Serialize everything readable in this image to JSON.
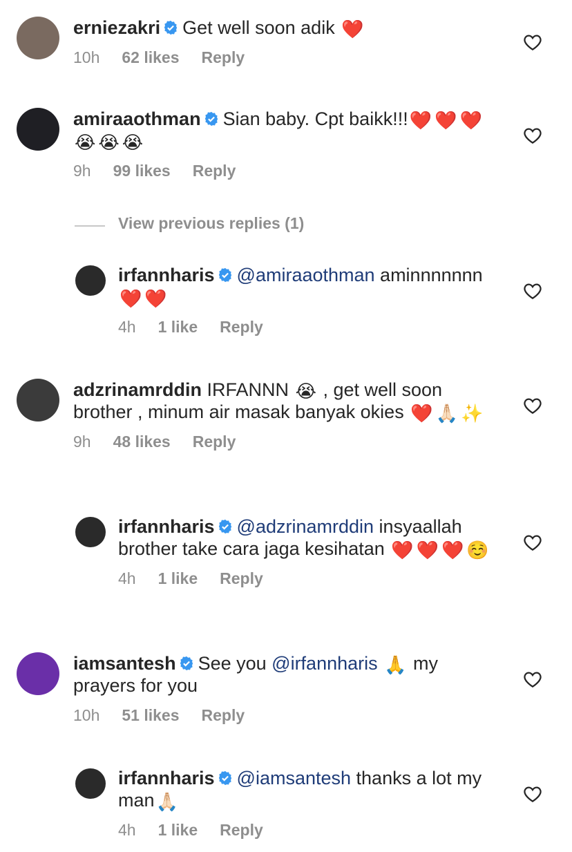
{
  "comments": [
    {
      "username": "erniezakri",
      "parts": [
        {
          "t": "text",
          "v": "Get well soon adik "
        },
        {
          "t": "emoji",
          "v": "❤️"
        }
      ],
      "time": "10h",
      "likes": "62 likes",
      "reply": "Reply",
      "avatar_color": "#7a6a60"
    },
    {
      "username": "amiraaothman",
      "parts": [
        {
          "t": "text",
          "v": "Sian baby. Cpt baikk!!!"
        },
        {
          "t": "emoji",
          "v": "❤️"
        },
        {
          "t": "emoji",
          "v": "❤️"
        },
        {
          "t": "emoji",
          "v": "❤️"
        },
        {
          "t": "emoji",
          "v": "😭"
        },
        {
          "t": "emoji",
          "v": "😭"
        },
        {
          "t": "emoji",
          "v": "😭"
        }
      ],
      "time": "9h",
      "likes": "99 likes",
      "reply": "Reply",
      "avatar_color": "#1f1f24"
    },
    {
      "username": "irfannharis",
      "parts": [
        {
          "t": "mention",
          "v": "@amiraaothman"
        },
        {
          "t": "text",
          "v": " aminnnnnnn"
        },
        {
          "t": "emoji",
          "v": "❤️"
        },
        {
          "t": "emoji",
          "v": "❤️"
        }
      ],
      "time": "4h",
      "likes": "1 like",
      "reply": "Reply",
      "avatar_color": "#2a2a2a"
    },
    {
      "username": "adzrinamrddin",
      "parts": [
        {
          "t": "text",
          "v": "IRFANNN "
        },
        {
          "t": "emoji",
          "v": "😭"
        },
        {
          "t": "text",
          "v": " , get well soon brother , minum air masak banyak okies "
        },
        {
          "t": "emoji",
          "v": "❤️"
        },
        {
          "t": "emoji",
          "v": "🙏🏻"
        },
        {
          "t": "emoji",
          "v": "✨"
        }
      ],
      "time": "9h",
      "likes": "48 likes",
      "reply": "Reply",
      "avatar_color": "#3b3b3b"
    },
    {
      "username": "irfannharis",
      "parts": [
        {
          "t": "mention",
          "v": "@adzrinamrddin"
        },
        {
          "t": "text",
          "v": " insyaallah brother take cara jaga kesihatan "
        },
        {
          "t": "emoji",
          "v": "❤️"
        },
        {
          "t": "emoji",
          "v": "❤️"
        },
        {
          "t": "emoji",
          "v": "❤️"
        },
        {
          "t": "emoji",
          "v": "☺️"
        }
      ],
      "time": "4h",
      "likes": "1 like",
      "reply": "Reply",
      "avatar_color": "#2a2a2a"
    },
    {
      "username": "iamsantesh",
      "parts": [
        {
          "t": "text",
          "v": "See you "
        },
        {
          "t": "mention",
          "v": "@irfannharis"
        },
        {
          "t": "text",
          "v": " "
        },
        {
          "t": "emoji",
          "v": "🙏"
        },
        {
          "t": "text",
          "v": " my prayers for you"
        }
      ],
      "time": "10h",
      "likes": "51 likes",
      "reply": "Reply",
      "avatar_color": "#6a2fa8"
    },
    {
      "username": "irfannharis",
      "parts": [
        {
          "t": "mention",
          "v": "@iamsantesh"
        },
        {
          "t": "text",
          "v": " thanks a lot my man"
        },
        {
          "t": "emoji",
          "v": "🙏🏻"
        }
      ],
      "time": "4h",
      "likes": "1 like",
      "reply": "Reply",
      "avatar_color": "#2a2a2a"
    }
  ],
  "view_previous_replies": "View previous replies (1)"
}
